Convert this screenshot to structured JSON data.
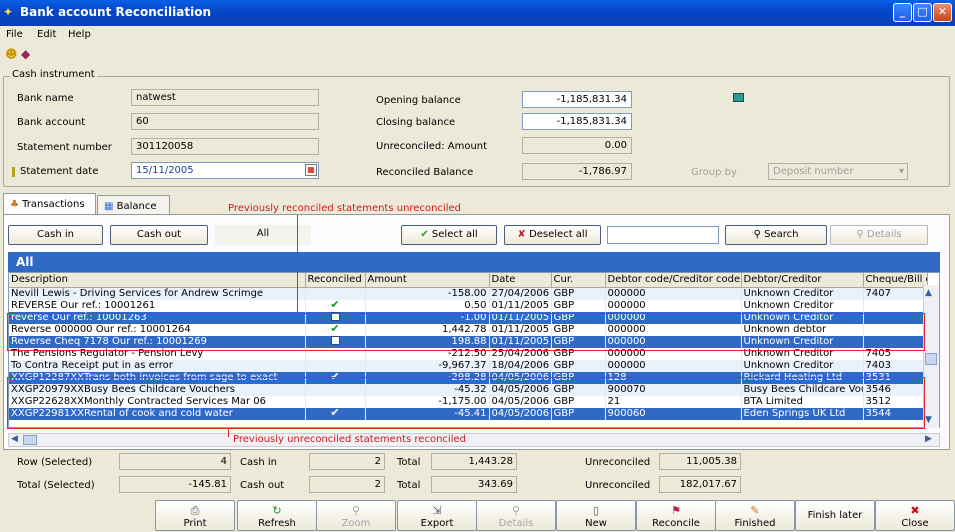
{
  "window": {
    "title": "Bank account Reconciliation"
  },
  "menu": [
    "File",
    "Edit",
    "Help"
  ],
  "cash_instrument": {
    "title": "Cash instrument",
    "bank_name_label": "Bank name",
    "bank_name": "natwest",
    "bank_account_label": "Bank account",
    "bank_account": "60",
    "statement_number_label": "Statement number",
    "statement_number": "301120058",
    "statement_date_label": "Statement date",
    "statement_date": "15/11/2005",
    "opening_balance_label": "Opening balance",
    "opening_balance": "-1,185,831.34",
    "closing_balance_label": "Closing balance",
    "closing_balance": "-1,185,831.34",
    "unreconciled_amount_label": "Unreconciled: Amount",
    "unreconciled_amount": "0.00",
    "reconciled_balance_label": "Reconciled Balance",
    "reconciled_balance": "-1,786.97",
    "group_by_label": "Group by",
    "group_by": "Deposit number"
  },
  "tabs": {
    "transactions": "Transactions",
    "balance": "Balance"
  },
  "filters": {
    "cash_in": "Cash in",
    "cash_out": "Cash out",
    "all": "All",
    "select_all": "Select all",
    "deselect_all": "Deselect all",
    "search": "Search",
    "details": "Details"
  },
  "grid": {
    "group_title": "All",
    "columns": [
      "Description",
      "Reconciled",
      "Amount",
      "Date",
      "Cur.",
      "Debtor code/Creditor code",
      "Debtor/Creditor",
      "Cheque/Bill of e"
    ],
    "rows": [
      {
        "desc": "Nevill Lewis - Driving Services for Andrew Scrimge",
        "rec": "",
        "amount": "-158.00",
        "date": "27/04/2006",
        "cur": "GBP",
        "code": "000000",
        "party": "Unknown Creditor",
        "cheque": "7407",
        "style": "alt"
      },
      {
        "desc": "REVERSE  Our ref.: 10001261",
        "rec": "tick",
        "amount": "0.50",
        "date": "01/11/2005",
        "cur": "GBP",
        "code": "000000",
        "party": "Unknown Creditor",
        "cheque": "",
        "style": ""
      },
      {
        "desc": "reverse  Our ref.: 10001263",
        "rec": "box",
        "amount": "-1.00",
        "date": "01/11/2005",
        "cur": "GBP",
        "code": "000000",
        "party": "Unknown Creditor",
        "cheque": "",
        "style": "sel"
      },
      {
        "desc": "Reverse 000000 Our ref.: 10001264",
        "rec": "tick",
        "amount": "1,442.78",
        "date": "01/11/2005",
        "cur": "GBP",
        "code": "000000",
        "party": "Unknown debtor",
        "cheque": "",
        "style": ""
      },
      {
        "desc": "Reverse Cheq 7178  Our ref.: 10001269",
        "rec": "box",
        "amount": "198.88",
        "date": "01/11/2005",
        "cur": "GBP",
        "code": "000000",
        "party": "Unknown Creditor",
        "cheque": "",
        "style": "sel"
      },
      {
        "desc": "The Pensions Regulator - Pension Levy",
        "rec": "",
        "amount": "-212.50",
        "date": "25/04/2006",
        "cur": "GBP",
        "code": "000000",
        "party": "Unknown Creditor",
        "cheque": "7405",
        "style": ""
      },
      {
        "desc": "To Contra Receipt put in as error",
        "rec": "",
        "amount": "-9,967.37",
        "date": "18/04/2006",
        "cur": "GBP",
        "code": "000000",
        "party": "Unknown Creditor",
        "cheque": "7403",
        "style": "alt"
      },
      {
        "desc": "XXGP12287XXTrans both invoices from sage to exact",
        "rec": "tick",
        "amount": "-298.28",
        "date": "04/05/2006",
        "cur": "GBP",
        "code": "128",
        "party": "Rickard Heating Ltd",
        "cheque": "3531",
        "style": "sel"
      },
      {
        "desc": "XXGP20979XXBusy Bees Childcare Vouchers",
        "rec": "",
        "amount": "-45.32",
        "date": "04/05/2006",
        "cur": "GBP",
        "code": "900070",
        "party": "Busy Bees Childcare Vou",
        "cheque": "3546",
        "style": "alt"
      },
      {
        "desc": "XXGP22628XXMonthly Contracted Services Mar 06",
        "rec": "",
        "amount": "-1,175.00",
        "date": "04/05/2006",
        "cur": "GBP",
        "code": "21",
        "party": "BTA Limited",
        "cheque": "3512",
        "style": ""
      },
      {
        "desc": "XXGP22981XXRental of cook and cold water",
        "rec": "tick",
        "amount": "-45.41",
        "date": "04/05/2006",
        "cur": "GBP",
        "code": "900060",
        "party": "Eden Springs UK Ltd",
        "cheque": "3544",
        "style": "sel"
      }
    ]
  },
  "annotations": {
    "top": "Previously reconciled statements unreconciled",
    "bottom": "Previously unreconciled statements reconciled"
  },
  "footer": {
    "row_selected_label": "Row (Selected)",
    "row_selected": "4",
    "total_selected_label": "Total (Selected)",
    "total_selected": "-145.81",
    "cash_in_label": "Cash in",
    "cash_in": "2",
    "cash_out_label": "Cash out",
    "cash_out": "2",
    "total_label": "Total",
    "total_in": "1,443.28",
    "total_out": "343.69",
    "unreconciled_label": "Unreconciled",
    "unreconciled_1": "11,005.38",
    "unreconciled_2": "182,017.67"
  },
  "buttons": {
    "print": "Print",
    "refresh": "Refresh",
    "zoom": "Zoom",
    "export": "Export",
    "details": "Details",
    "new": "New",
    "reconcile": "Reconcile",
    "finished": "Finished",
    "finish_later": "Finish later",
    "close": "Close"
  }
}
